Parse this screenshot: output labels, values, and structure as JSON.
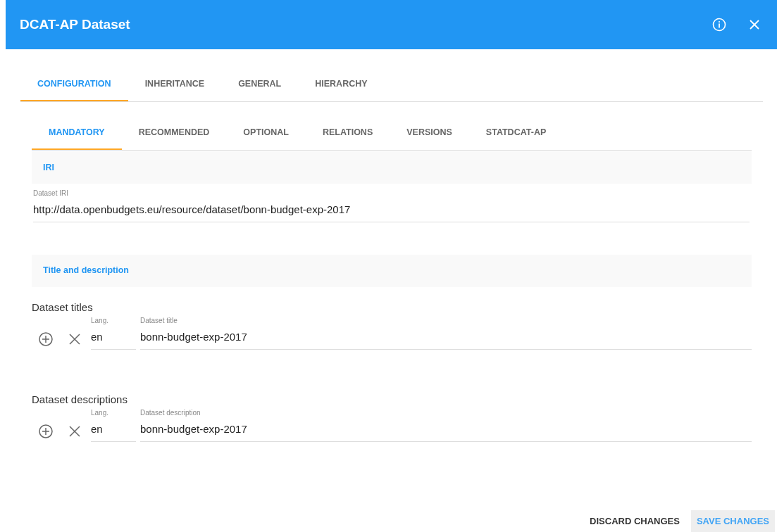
{
  "dialog": {
    "title": "DCAT-AP Dataset"
  },
  "tabs": [
    {
      "label": "CONFIGURATION",
      "selected": true
    },
    {
      "label": "INHERITANCE",
      "selected": false
    },
    {
      "label": "GENERAL",
      "selected": false
    },
    {
      "label": "HIERARCHY",
      "selected": false
    }
  ],
  "subtabs": [
    {
      "label": "MANDATORY",
      "selected": true
    },
    {
      "label": "RECOMMENDED",
      "selected": false
    },
    {
      "label": "OPTIONAL",
      "selected": false
    },
    {
      "label": "RELATIONS",
      "selected": false
    },
    {
      "label": "VERSIONS",
      "selected": false
    },
    {
      "label": "STATDCAT-AP",
      "selected": false
    }
  ],
  "sections": [
    {
      "heading": "IRI",
      "blocks": [
        {
          "kind": "field",
          "label": "Dataset IRI",
          "value": "http://data.openbudgets.eu/resource/dataset/bonn-budget-exp-2017"
        }
      ]
    },
    {
      "heading": "Title and description",
      "blocks": [
        {
          "kind": "multilang",
          "title": "Dataset titles",
          "lang_label": "Lang.",
          "lang": "en",
          "label": "Dataset title",
          "value": "bonn-budget-exp-2017"
        },
        {
          "kind": "multilang",
          "title": "Dataset descriptions",
          "lang_label": "Lang.",
          "lang": "en",
          "label": "Dataset description",
          "value": "bonn-budget-exp-2017"
        }
      ]
    }
  ],
  "footer": {
    "buttons": [
      {
        "label": "DISCARD CHANGES",
        "kind": "plain"
      },
      {
        "label": "SAVE CHANGES",
        "kind": "primary"
      }
    ]
  }
}
